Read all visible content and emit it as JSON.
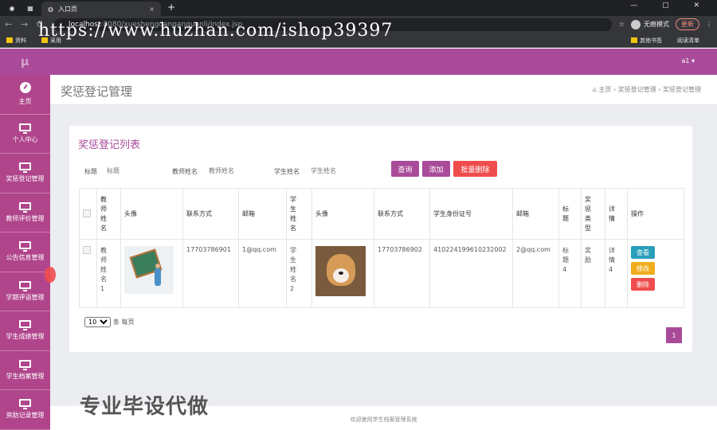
{
  "browser": {
    "tab_label": "入口页",
    "tab_close": "×",
    "new_tab": "+",
    "window_controls": "—  ▢  ✕",
    "nav_back": "←",
    "nav_forward": "→",
    "nav_reload": "C",
    "url_host": "localhost",
    "url_rest": ":8080/xueshengdanganguanli/index.jsp",
    "incognito_label": "无痕模式",
    "update_label": "更新",
    "bookmarks": [
      "资料",
      "采用"
    ],
    "bookmarks_right": [
      "其他书签",
      "阅读清单"
    ]
  },
  "overlay_watermark": "https://www.huzhan.com/ishop39397",
  "big_watermark": "专业毕设代做",
  "topbar": {
    "logo": "μ",
    "user": "a1 ▾"
  },
  "sidebar": {
    "items": [
      {
        "label": "主页",
        "icon": "dashboard-icon"
      },
      {
        "label": "个人中心",
        "icon": "monitor-icon"
      },
      {
        "label": "奖惩登记管理",
        "icon": "monitor-icon"
      },
      {
        "label": "教师评价管理",
        "icon": "monitor-icon"
      },
      {
        "label": "公告信息管理",
        "icon": "monitor-icon"
      },
      {
        "label": "学期评语管理",
        "icon": "monitor-icon"
      },
      {
        "label": "学生成绩管理",
        "icon": "monitor-icon"
      },
      {
        "label": "学生档案管理",
        "icon": "monitor-icon"
      },
      {
        "label": "资助记录管理",
        "icon": "monitor-icon"
      }
    ]
  },
  "page": {
    "title": "奖惩登记管理",
    "breadcrumb": "⌂ 主页  ›  奖惩登记管理  ›  奖惩登记管理",
    "card_title": "奖惩登记列表"
  },
  "search": {
    "title_label": "标题",
    "title_placeholder": "标题",
    "teacher_label": "教师姓名",
    "teacher_placeholder": "教师姓名",
    "student_label": "学生姓名",
    "student_placeholder": "学生姓名",
    "query_btn": "查询",
    "add_btn": "添加",
    "batch_delete_btn": "批量删除"
  },
  "table": {
    "headers": [
      "教师姓名",
      "头像",
      "联系方式",
      "邮箱",
      "学生姓名",
      "头像",
      "联系方式",
      "学生身份证号",
      "邮箱",
      "标题",
      "奖惩类型",
      "详情",
      "操作"
    ],
    "rows": [
      {
        "teacher_name": "教师姓名1",
        "teacher_phone": "17703786901",
        "teacher_email": "1@qq.com",
        "student_name": "学生姓名2",
        "student_phone": "17703786902",
        "student_id": "410224199610232002",
        "student_email": "2@qq.com",
        "title": "标题4",
        "type": "奖励",
        "detail": "详情4",
        "view_btn": "查看",
        "edit_btn": "修改",
        "delete_btn": "删除"
      }
    ]
  },
  "pagination": {
    "page_size": "10",
    "per_page_label": "条 每页",
    "current_page": "1"
  },
  "footer": "欢迎使用学生档案管理系统",
  "colors": {
    "brand": "#a94b9a",
    "sidebar": "#b0458c",
    "danger": "#ef4d4d",
    "info": "#2a9fba",
    "warning": "#f0ad1e"
  }
}
